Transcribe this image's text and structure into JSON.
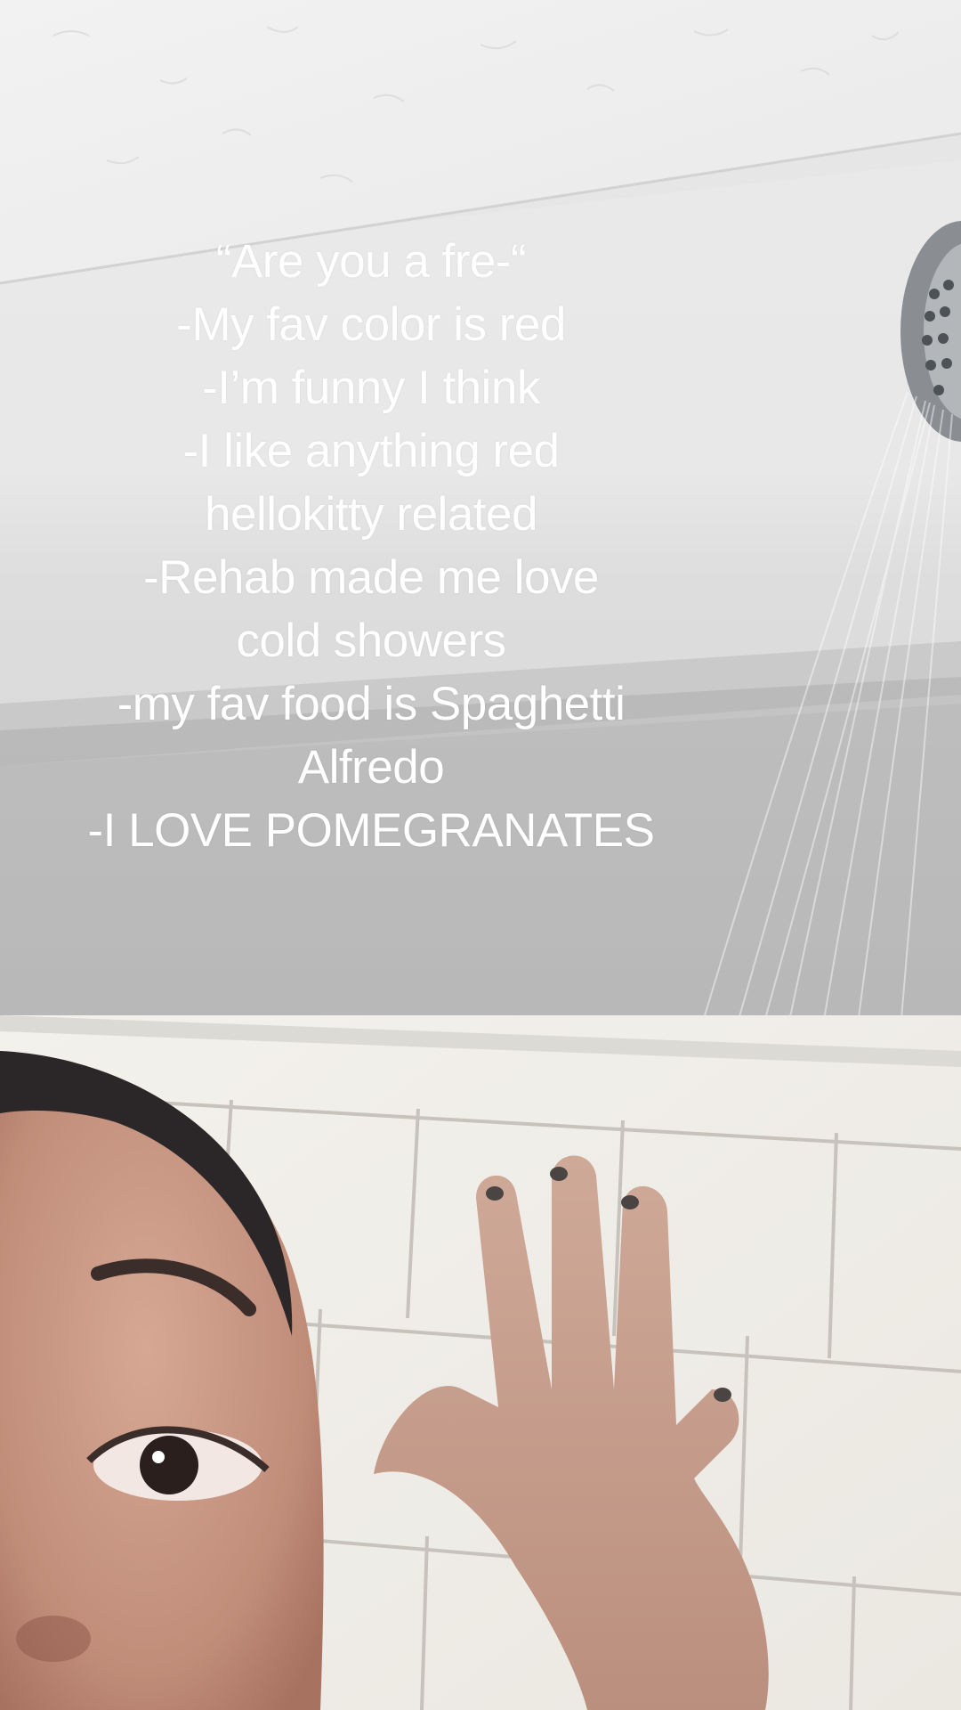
{
  "caption": {
    "lines": [
      "“Are you a fre-“",
      "-My fav color is red",
      "-I’m funny I think",
      "-I like anything red",
      "hellokitty related",
      "-Rehab made me love",
      "cold showers",
      "-my fav food is Spaghetti",
      "Alfredo",
      "-I LOVE POMEGRANATES"
    ]
  },
  "colors": {
    "ceiling": "#efefef",
    "wall_light": "#e6e6e6",
    "wall_shadow": "#bdbdbd",
    "tile": "#f4f2ee",
    "grout": "#c9c6c0",
    "skin": "#c99a86",
    "hair": "#2b2627",
    "text": "#ffffff"
  }
}
